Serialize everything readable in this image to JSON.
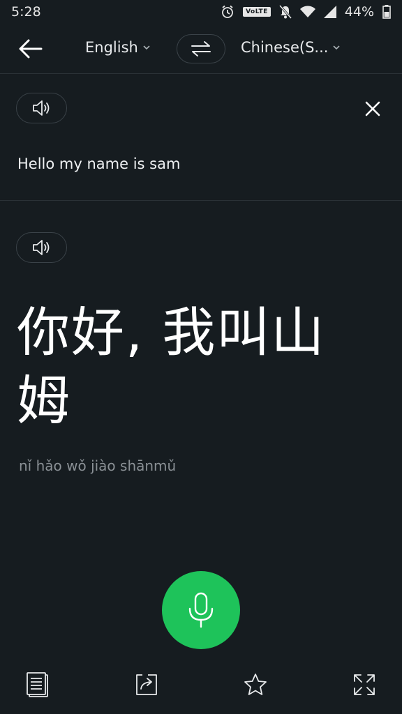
{
  "status_bar": {
    "time": "5:28",
    "volte_label": "VoLTE",
    "battery": "44%"
  },
  "toolbar": {
    "source_language": "English",
    "target_language": "Chinese(S..."
  },
  "source": {
    "text": "Hello my name is sam"
  },
  "target": {
    "translation": "你好, 我叫山姆",
    "pinyin": "nǐ hǎo wǒ jiào shānmǔ"
  },
  "icons": {
    "back": "arrow-left-icon",
    "swap": "swap-arrows-icon",
    "speaker": "speaker-icon",
    "close": "close-icon",
    "mic": "microphone-icon",
    "copy": "document-icon",
    "share": "share-icon",
    "favorite": "star-icon",
    "fullscreen": "expand-icon"
  },
  "colors": {
    "background": "#161c20",
    "mic_accent": "#1ec35a",
    "pinyin": "#8a9095"
  }
}
